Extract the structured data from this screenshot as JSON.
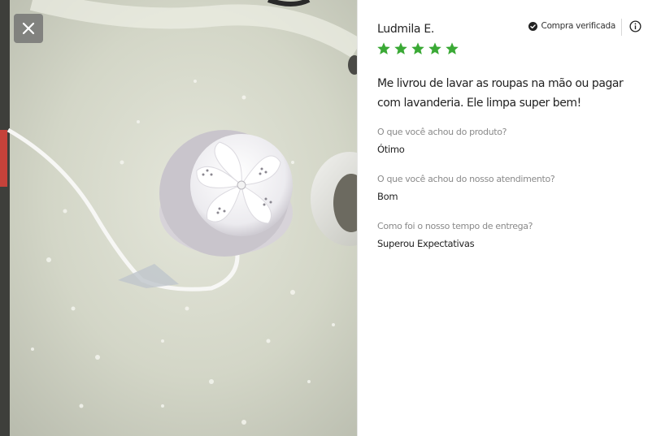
{
  "colors": {
    "star": "#3aa935",
    "verified_icon": "#222222",
    "question_text": "#8a8a8a",
    "close_button_bg": "#6e6e6e"
  },
  "photo": {
    "alt": "Foto do cliente: mini lavadora branca dentro de uma pia"
  },
  "close": {
    "icon": "close-icon"
  },
  "review": {
    "author": "Ludmila E.",
    "verified_label": "Compra verificada",
    "verified_icon": "check-circle-icon",
    "info_icon": "info-icon",
    "rating": 5,
    "rating_max": 5,
    "comment": "Me livrou de lavar as roupas na mão ou pagar com lavanderia. Ele limpa super bem!",
    "questions": [
      {
        "question": "O que você achou do produto?",
        "answer": "Ótimo"
      },
      {
        "question": "O que você achou do nosso atendimento?",
        "answer": "Bom"
      },
      {
        "question": "Como foi o nosso tempo de entrega?",
        "answer": "Superou Expectativas"
      }
    ]
  }
}
